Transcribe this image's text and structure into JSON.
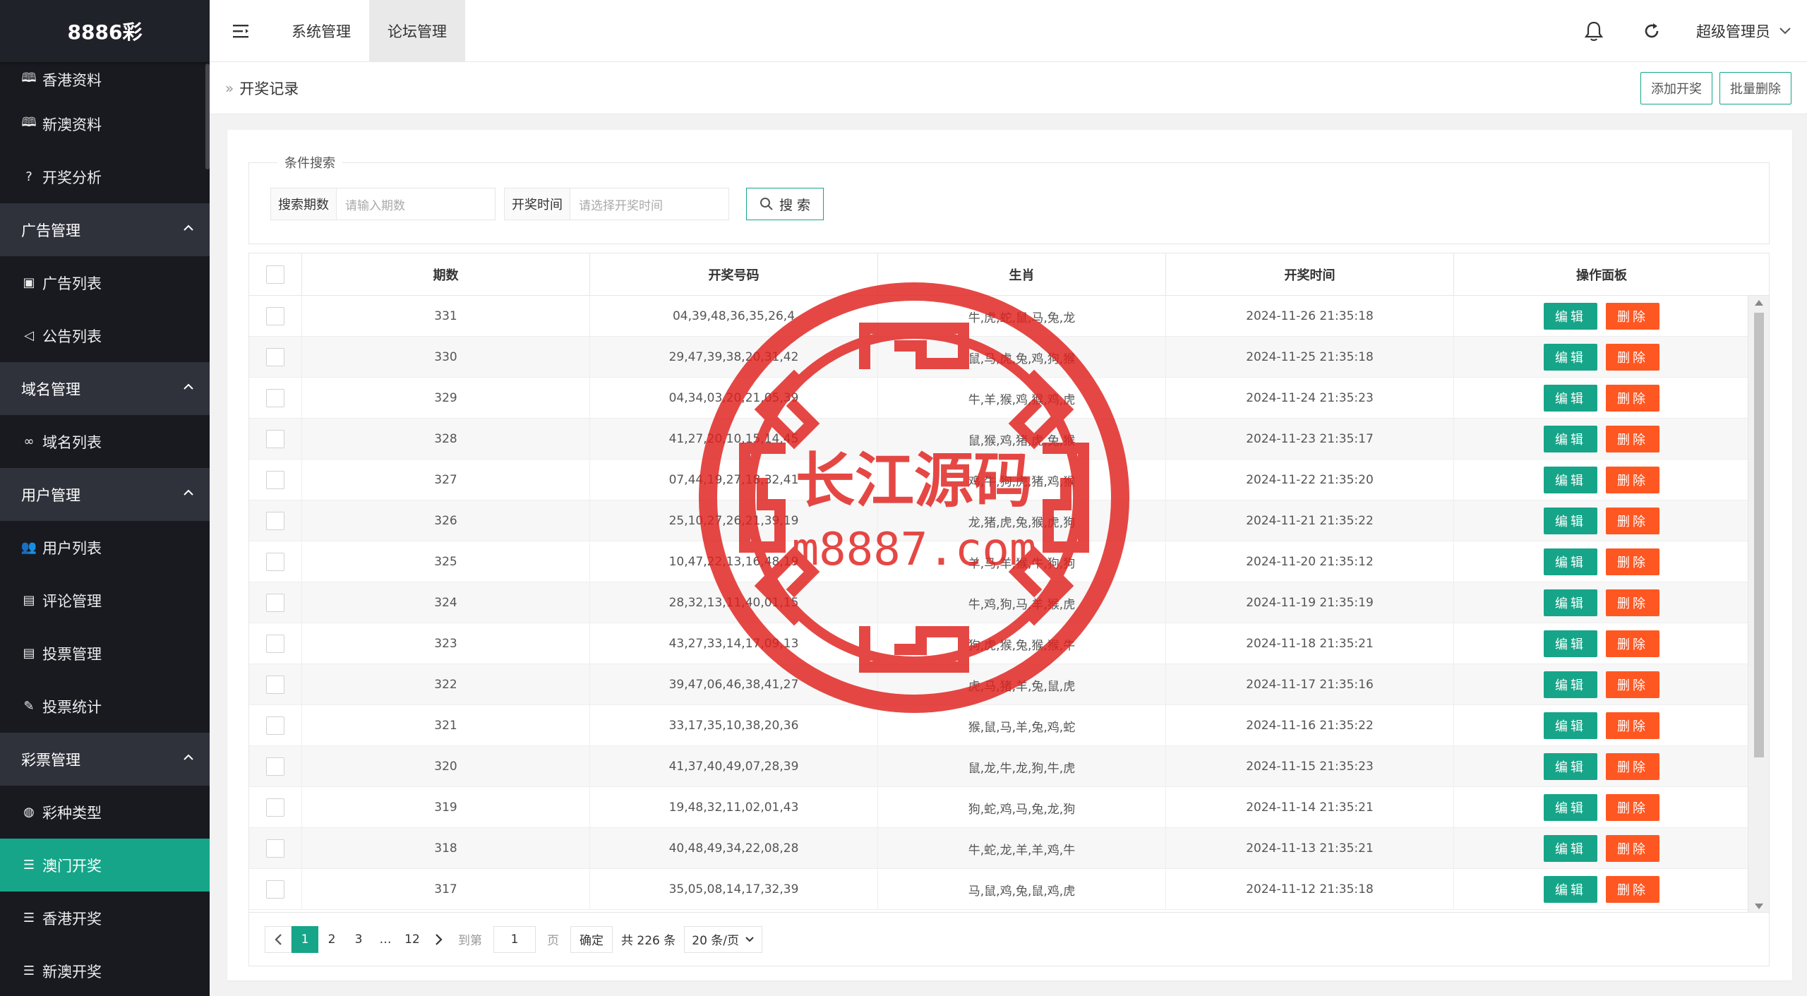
{
  "app": {
    "logo": "8886彩"
  },
  "sidebar": {
    "items": [
      {
        "type": "sub",
        "label": "香港资料",
        "icon": "book-icon",
        "glyph": "🕮",
        "partial": true
      },
      {
        "type": "sub",
        "label": "新澳资料",
        "icon": "book-icon",
        "glyph": "🕮"
      },
      {
        "type": "sub",
        "label": "开奖分析",
        "icon": "help-circle-icon",
        "glyph": "?"
      },
      {
        "type": "group",
        "label": "广告管理"
      },
      {
        "type": "sub",
        "label": "广告列表",
        "icon": "picture-icon",
        "glyph": "▣"
      },
      {
        "type": "sub",
        "label": "公告列表",
        "icon": "speaker-icon",
        "glyph": "◁"
      },
      {
        "type": "group",
        "label": "域名管理"
      },
      {
        "type": "sub",
        "label": "域名列表",
        "icon": "link-icon",
        "glyph": "∞"
      },
      {
        "type": "group",
        "label": "用户管理"
      },
      {
        "type": "sub",
        "label": "用户列表",
        "icon": "users-icon",
        "glyph": "👥"
      },
      {
        "type": "sub",
        "label": "评论管理",
        "icon": "document-icon",
        "glyph": "▤"
      },
      {
        "type": "sub",
        "label": "投票管理",
        "icon": "document-icon",
        "glyph": "▤"
      },
      {
        "type": "sub",
        "label": "投票统计",
        "icon": "edit-icon",
        "glyph": "✎"
      },
      {
        "type": "group",
        "label": "彩票管理"
      },
      {
        "type": "sub",
        "label": "彩种类型",
        "icon": "palette-icon",
        "glyph": "◍"
      },
      {
        "type": "active",
        "label": "澳门开奖",
        "icon": "list-icon",
        "glyph": "☰"
      },
      {
        "type": "sub",
        "label": "香港开奖",
        "icon": "list-icon",
        "glyph": "☰"
      },
      {
        "type": "sub",
        "label": "新澳开奖",
        "icon": "list-icon",
        "glyph": "☰"
      }
    ]
  },
  "topnav": {
    "tabs": [
      {
        "label": "系统管理",
        "active": false
      },
      {
        "label": "论坛管理",
        "active": true
      }
    ],
    "user": "超级管理员"
  },
  "breadcrumb": {
    "current": "开奖记录"
  },
  "actions": {
    "add": "添加开奖",
    "batch_delete": "批量删除"
  },
  "search": {
    "legend": "条件搜索",
    "period_label": "搜索期数",
    "period_placeholder": "请输入期数",
    "time_label": "开奖时间",
    "time_placeholder": "请选择开奖时间",
    "button": "搜 索"
  },
  "table": {
    "headers": {
      "period": "期数",
      "numbers": "开奖号码",
      "zodiac": "生肖",
      "time": "开奖时间",
      "ops": "操作面板"
    },
    "edit_label": "编辑",
    "delete_label": "删除",
    "rows": [
      {
        "period": "331",
        "numbers": "04,39,48,36,35,26,4",
        "zodiac": "牛,虎,蛇,鼠,马,兔,龙",
        "time": "2024-11-26 21:35:18"
      },
      {
        "period": "330",
        "numbers": "29,47,39,38,20,31,42",
        "zodiac": "鼠,马,虎,兔,鸡,狗,猴",
        "time": "2024-11-25 21:35:18"
      },
      {
        "period": "329",
        "numbers": "04,34,03,20,21,05,39",
        "zodiac": "牛,羊,猴,鸡,猴,鸡,虎",
        "time": "2024-11-24 21:35:23"
      },
      {
        "period": "328",
        "numbers": "41,27,20,10,15,14,45",
        "zodiac": "鼠,猴,鸡,猪,虎,兔,猴",
        "time": "2024-11-23 21:35:17"
      },
      {
        "period": "327",
        "numbers": "07,44,19,27,18,32,41",
        "zodiac": "鸡,牛,狗,虎,猪,鸡,猴",
        "time": "2024-11-22 21:35:20"
      },
      {
        "period": "326",
        "numbers": "25,10,27,26,21,39,19",
        "zodiac": "龙,猪,虎,兔,猴,虎,狗",
        "time": "2024-11-21 21:35:22"
      },
      {
        "period": "325",
        "numbers": "10,47,22,13,16,48,19",
        "zodiac": "羊,马,羊,猴,牛,狗,狗",
        "time": "2024-11-20 21:35:12"
      },
      {
        "period": "324",
        "numbers": "28,32,13,11,40,01,15",
        "zodiac": "牛,鸡,狗,马,羊,猴,虎",
        "time": "2024-11-19 21:35:19"
      },
      {
        "period": "323",
        "numbers": "43,27,33,14,17,09,13",
        "zodiac": "狗,虎,猴,兔,猴,猴,牛",
        "time": "2024-11-18 21:35:21"
      },
      {
        "period": "322",
        "numbers": "39,47,06,46,38,41,27",
        "zodiac": "虎,马,猪,羊,兔,鼠,虎",
        "time": "2024-11-17 21:35:16"
      },
      {
        "period": "321",
        "numbers": "33,17,35,10,38,20,36",
        "zodiac": "猴,鼠,马,羊,兔,鸡,蛇",
        "time": "2024-11-16 21:35:22"
      },
      {
        "period": "320",
        "numbers": "41,37,40,49,07,28,39",
        "zodiac": "鼠,龙,牛,龙,狗,牛,虎",
        "time": "2024-11-15 21:35:23"
      },
      {
        "period": "319",
        "numbers": "19,48,32,11,02,01,43",
        "zodiac": "狗,蛇,鸡,马,兔,龙,狗",
        "time": "2024-11-14 21:35:21"
      },
      {
        "period": "318",
        "numbers": "40,48,49,34,22,08,28",
        "zodiac": "牛,蛇,龙,羊,羊,鸡,牛",
        "time": "2024-11-13 21:35:21"
      },
      {
        "period": "317",
        "numbers": "35,05,08,14,17,32,39",
        "zodiac": "马,鼠,鸡,兔,鼠,鸡,虎",
        "time": "2024-11-12 21:35:18"
      }
    ]
  },
  "pager": {
    "pages": [
      "1",
      "2",
      "3",
      "…",
      "12"
    ],
    "current": "1",
    "goto_label": "到第",
    "goto_value": "1",
    "page_unit": "页",
    "confirm": "确定",
    "total": "共 226 条",
    "per_page": "20 条/页"
  },
  "watermark": {
    "line1": "长江源码",
    "line2": "m8887.com"
  },
  "colors": {
    "accent": "#16a589",
    "danger": "#ff5722",
    "sidebar": "#20222a",
    "watermark": "#e0201c"
  }
}
